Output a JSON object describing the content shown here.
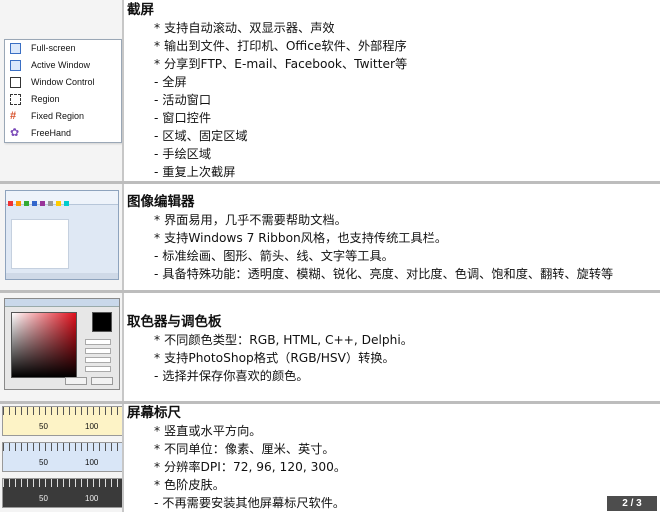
{
  "sections": [
    {
      "title": "截屏",
      "lines": [
        "* 支持自动滚动、双显示器、声效",
        "* 输出到文件、打印机、Office软件、外部程序",
        "* 分享到FTP、E-mail、Facebook、Twitter等",
        "- 全屏",
        "- 活动窗口",
        "- 窗口控件",
        "- 区域、固定区域",
        "- 手绘区域",
        "- 重复上次截屏"
      ]
    },
    {
      "title": "图像编辑器",
      "lines": [
        "* 界面易用，几乎不需要帮助文档。",
        "* 支持Windows 7 Ribbon风格，也支持传统工具栏。",
        "- 标准绘画、图形、箭头、线、文字等工具。",
        "- 具备特殊功能：透明度、模糊、锐化、亮度、对比度、色调、饱和度、翻转、旋转等"
      ]
    },
    {
      "title": "取色器与调色板",
      "lines": [
        "* 不同颜色类型：RGB, HTML, C++, Delphi。",
        "* 支持PhotoShop格式（RGB/HSV）转换。",
        "- 选择并保存你喜欢的颜色。"
      ]
    },
    {
      "title": "屏幕标尺",
      "lines": [
        "* 竖直或水平方向。",
        "* 不同单位：像素、厘米、英寸。",
        "* 分辨率DPI：72, 96, 120, 300。",
        "* 色阶皮肤。",
        "- 不再需要安装其他屏幕标尺软件。"
      ]
    }
  ],
  "capture_menu": {
    "items": [
      {
        "label": "Full-screen",
        "icon": "monitor-icon"
      },
      {
        "label": "Active Window",
        "icon": "window-icon"
      },
      {
        "label": "Window Control",
        "icon": "window-control-icon"
      },
      {
        "label": "Region",
        "icon": "region-icon"
      },
      {
        "label": "Fixed Region",
        "icon": "fixed-region-icon"
      },
      {
        "label": "FreeHand",
        "icon": "freehand-icon"
      }
    ]
  },
  "rulers": {
    "labels": [
      "50",
      "100"
    ],
    "colors": [
      "#fdf3c6",
      "#d9e6f7",
      "#3a3a3a"
    ]
  },
  "pagination": {
    "text": "2 / 3"
  }
}
